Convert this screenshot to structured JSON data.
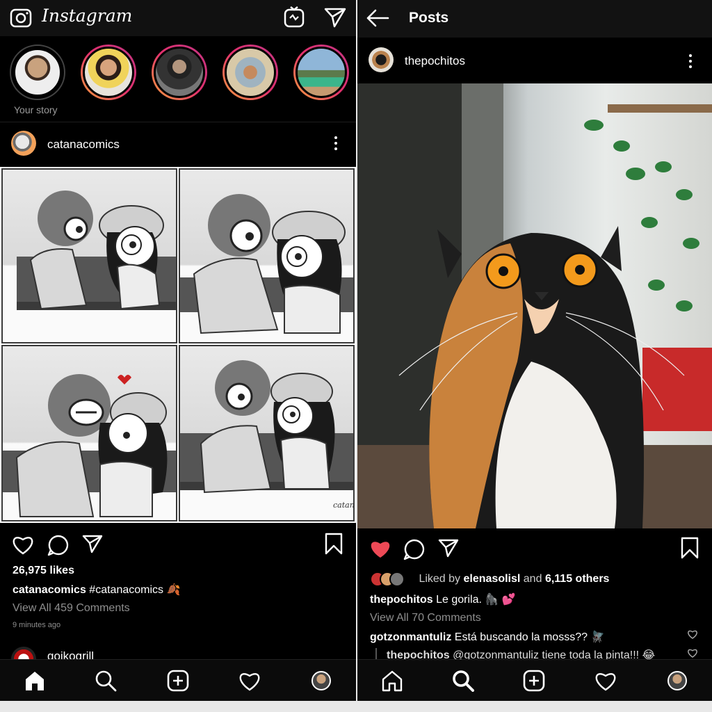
{
  "left": {
    "app_title": "Instagram",
    "stories": {
      "own_label": "Your story"
    },
    "post": {
      "username": "catanacomics",
      "watermark": "catana comics",
      "likes": "26,975 likes",
      "caption_user": "catanacomics",
      "caption_text": "#catanacomics",
      "caption_emoji": "🍂",
      "view_comments": "View All 459 Comments",
      "timestamp": "9 minutes ago"
    },
    "next_post_username": "goikogrill",
    "nav": [
      "home-icon",
      "search-icon",
      "add-icon",
      "heart-icon",
      "profile-avatar"
    ]
  },
  "right": {
    "title": "Posts",
    "post": {
      "username": "thepochitos",
      "liked_prefix": "Liked by",
      "liked_user": "elenasolisl",
      "liked_and": "and",
      "liked_others": "6,115 others",
      "caption_user": "thepochitos",
      "caption_text": "Le gorila.",
      "caption_emoji": "🦍 💕",
      "view_comments": "View All 70 Comments",
      "comment_user": "gotzonmantuliz",
      "comment_text": "Está buscando la mosss??",
      "comment_emoji": "🪰",
      "reply_user": "thepochitos",
      "reply_text": "@gotzonmantuliz tiene toda la pinta!!!",
      "reply_emoji": "😂"
    },
    "nav": [
      "home-icon",
      "search-icon",
      "add-icon",
      "heart-icon",
      "profile-avatar"
    ]
  },
  "colors": {
    "background": "#000000",
    "text": "#ffffff",
    "muted": "#8e8e8e",
    "liked_heart": "#ed4956",
    "story_ring": "#e1306c"
  }
}
